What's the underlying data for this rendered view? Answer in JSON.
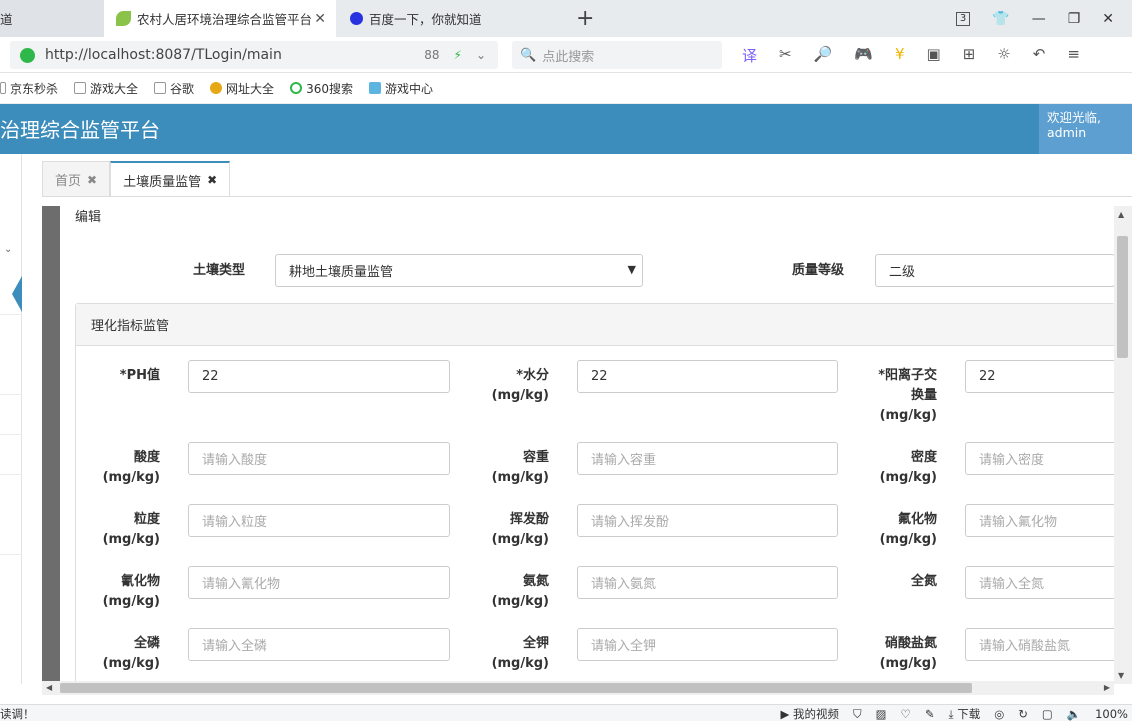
{
  "browser": {
    "tabs": [
      {
        "label": "道"
      },
      {
        "label": "农村人居环境治理综合监管平台"
      },
      {
        "label": "百度一下，你就知道"
      }
    ],
    "tab_count": "3",
    "url": "http://localhost:8087/TLogin/main",
    "url_extra": "88",
    "search_placeholder": "点此搜索",
    "bookmarks": [
      "京东秒杀",
      "游戏大全",
      "谷歌",
      "网址大全",
      "360搜索",
      "游戏中心"
    ]
  },
  "app": {
    "title": "治理综合监管平台",
    "welcome_line1": "欢迎光临,",
    "welcome_line2": "admin"
  },
  "content_tabs": [
    {
      "label": "首页"
    },
    {
      "label": "土壤质量监管"
    }
  ],
  "form": {
    "edit_title": "编辑",
    "soil_type_label": "土壤类型",
    "soil_type_value": "耕地土壤质量监管",
    "grade_label": "质量等级",
    "grade_value": "二级",
    "section_title": "理化指标监管",
    "fields": [
      {
        "label1": "*PH值",
        "label2": "",
        "label3": "",
        "value": "22",
        "placeholder": ""
      },
      {
        "label1": "*水分",
        "label2": "(mg/kg)",
        "label3": "",
        "value": "22",
        "placeholder": ""
      },
      {
        "label1": "*阳离子交",
        "label2": "换量",
        "label3": "(mg/kg)",
        "value": "22",
        "placeholder": ""
      },
      {
        "label1": "酸度",
        "label2": "(mg/kg)",
        "label3": "",
        "value": "",
        "placeholder": "请输入酸度"
      },
      {
        "label1": "容重",
        "label2": "(mg/kg)",
        "label3": "",
        "value": "",
        "placeholder": "请输入容重"
      },
      {
        "label1": "密度",
        "label2": "(mg/kg)",
        "label3": "",
        "value": "",
        "placeholder": "请输入密度"
      },
      {
        "label1": "粒度",
        "label2": "(mg/kg)",
        "label3": "",
        "value": "",
        "placeholder": "请输入粒度"
      },
      {
        "label1": "挥发酚",
        "label2": "(mg/kg)",
        "label3": "",
        "value": "",
        "placeholder": "请输入挥发酚"
      },
      {
        "label1": "氟化物",
        "label2": "(mg/kg)",
        "label3": "",
        "value": "",
        "placeholder": "请输入氟化物"
      },
      {
        "label1": "氰化物",
        "label2": "(mg/kg)",
        "label3": "",
        "value": "",
        "placeholder": "请输入氰化物"
      },
      {
        "label1": "氨氮",
        "label2": "(mg/kg)",
        "label3": "",
        "value": "",
        "placeholder": "请输入氨氮"
      },
      {
        "label1": "全氮",
        "label2": "",
        "label3": "",
        "value": "",
        "placeholder": "请输入全氮"
      },
      {
        "label1": "全磷",
        "label2": "(mg/kg)",
        "label3": "",
        "value": "",
        "placeholder": "请输入全磷"
      },
      {
        "label1": "全钾",
        "label2": "(mg/kg)",
        "label3": "",
        "value": "",
        "placeholder": "请输入全钾"
      },
      {
        "label1": "硝酸盐氮",
        "label2": "(mg/kg)",
        "label3": "",
        "value": "",
        "placeholder": "请输入硝酸盐氮"
      }
    ]
  },
  "statusbar": {
    "left_text": "读调！",
    "video_label": "我的视频",
    "download_label": "下载",
    "zoom": "100%"
  },
  "colors": {
    "header_bg": "#3c8dbc",
    "welcome_bg": "#5d9fd0"
  }
}
